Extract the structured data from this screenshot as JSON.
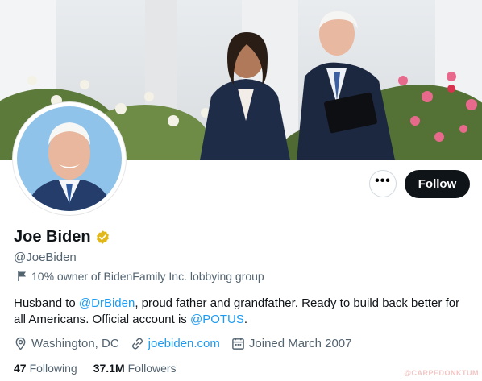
{
  "profile": {
    "name": "Joe Biden",
    "handle": "@JoeBiden",
    "affiliation": "10% owner of BidenFamily Inc. lobbying group",
    "bio": {
      "part1": "Husband to ",
      "mention1": "@DrBiden",
      "part2": ", proud father and grandfather. Ready to build back better for all Americans. Official account is ",
      "mention2": "@POTUS",
      "part3": "."
    },
    "location": "Washington, DC",
    "website": "joebiden.com",
    "joined": "Joined March 2007"
  },
  "actions": {
    "more_label": "•••",
    "follow_label": "Follow"
  },
  "stats": {
    "following_count": "47",
    "following_label": "Following",
    "followers_count": "37.1M",
    "followers_label": "Followers"
  },
  "watermark": "@CARPEDONKTUM",
  "icons": {
    "verified": "verified-badge-icon",
    "flag": "flag-icon",
    "location": "location-pin-icon",
    "link": "link-icon",
    "calendar": "calendar-icon"
  },
  "colors": {
    "accent": "#1d9bf0",
    "follow_bg": "#0f1419",
    "verified_gold": "#e2b719",
    "secondary_text": "#536471"
  }
}
